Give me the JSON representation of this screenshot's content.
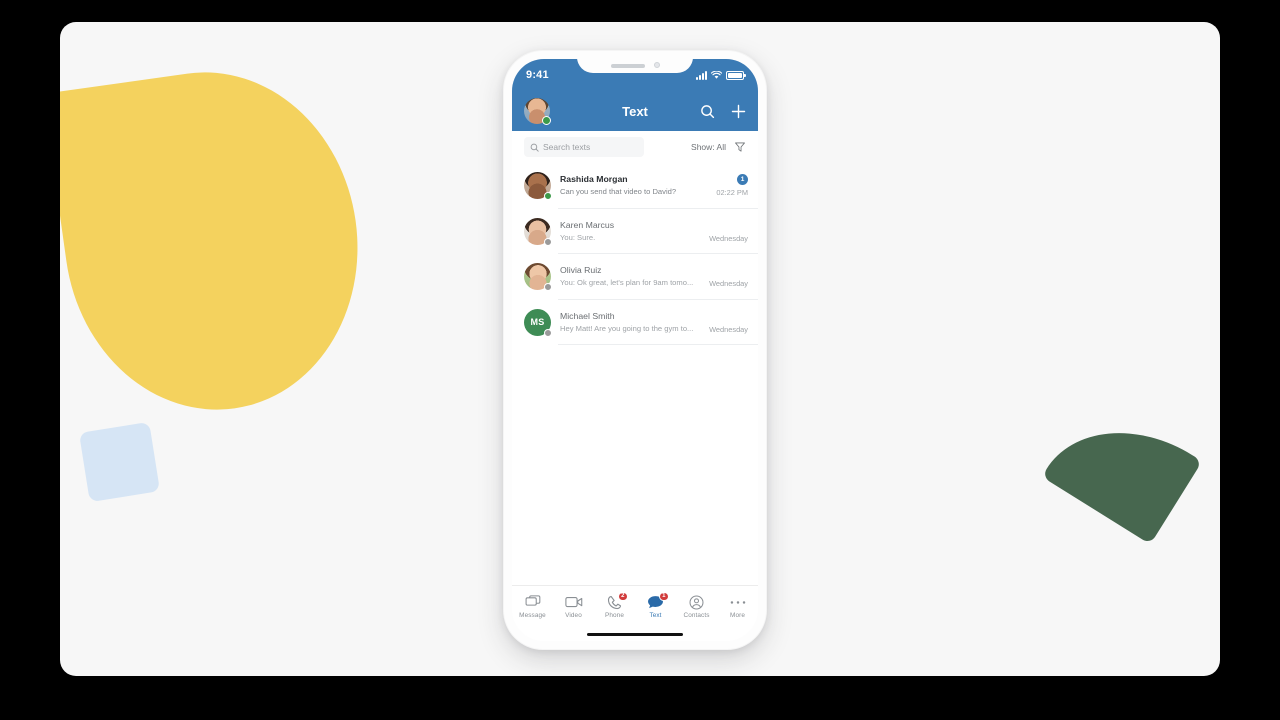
{
  "colors": {
    "brand_blue": "#3b7bb5",
    "badge_red": "#d13c3c",
    "presence_online": "#3d9a4a",
    "presence_offline": "#9a9a9a",
    "avatar_green": "#3e8c55",
    "shape_yellow": "#f4d25e",
    "shape_blue": "#d6e5f5",
    "shape_green": "#47674f",
    "card_background": "#f7f7f7"
  },
  "status_bar": {
    "time": "9:41",
    "signal_icon": "cellular-bars-icon",
    "wifi_icon": "wifi-icon",
    "battery_icon": "battery-full-icon"
  },
  "header": {
    "title": "Text",
    "avatar_name": "user-avatar",
    "avatar_presence": "online",
    "search_icon": "search-icon",
    "add_icon": "plus-icon"
  },
  "search": {
    "placeholder": "Search texts",
    "icon": "search-icon",
    "show_label": "Show: All",
    "filter_icon": "filter-icon"
  },
  "conversations": [
    {
      "name": "Rashida Morgan",
      "preview": "Can you send that video to David?",
      "time": "02:22 PM",
      "unread": true,
      "badge": "1",
      "presence": "online",
      "avatar_type": "photo",
      "initials": ""
    },
    {
      "name": "Karen Marcus",
      "preview": "You: Sure.",
      "time": "Wednesday",
      "unread": false,
      "badge": "",
      "presence": "offline",
      "avatar_type": "photo",
      "initials": ""
    },
    {
      "name": "Olivia Ruiz",
      "preview": "You: Ok great, let's plan for 9am tomo...",
      "time": "Wednesday",
      "unread": false,
      "badge": "",
      "presence": "offline",
      "avatar_type": "photo",
      "initials": ""
    },
    {
      "name": "Michael Smith",
      "preview": "Hey Matt! Are you going to the gym to...",
      "time": "Wednesday",
      "unread": false,
      "badge": "",
      "presence": "offline",
      "avatar_type": "initials",
      "initials": "MS"
    }
  ],
  "tabs": [
    {
      "label": "Message",
      "icon": "chat-bubbles-icon",
      "badge": "",
      "active": false
    },
    {
      "label": "Video",
      "icon": "video-camera-icon",
      "badge": "",
      "active": false
    },
    {
      "label": "Phone",
      "icon": "phone-handset-icon",
      "badge": "2",
      "active": false
    },
    {
      "label": "Text",
      "icon": "text-bubble-icon",
      "badge": "1",
      "active": true
    },
    {
      "label": "Contacts",
      "icon": "person-circle-icon",
      "badge": "",
      "active": false
    },
    {
      "label": "More",
      "icon": "ellipsis-icon",
      "badge": "",
      "active": false
    }
  ]
}
